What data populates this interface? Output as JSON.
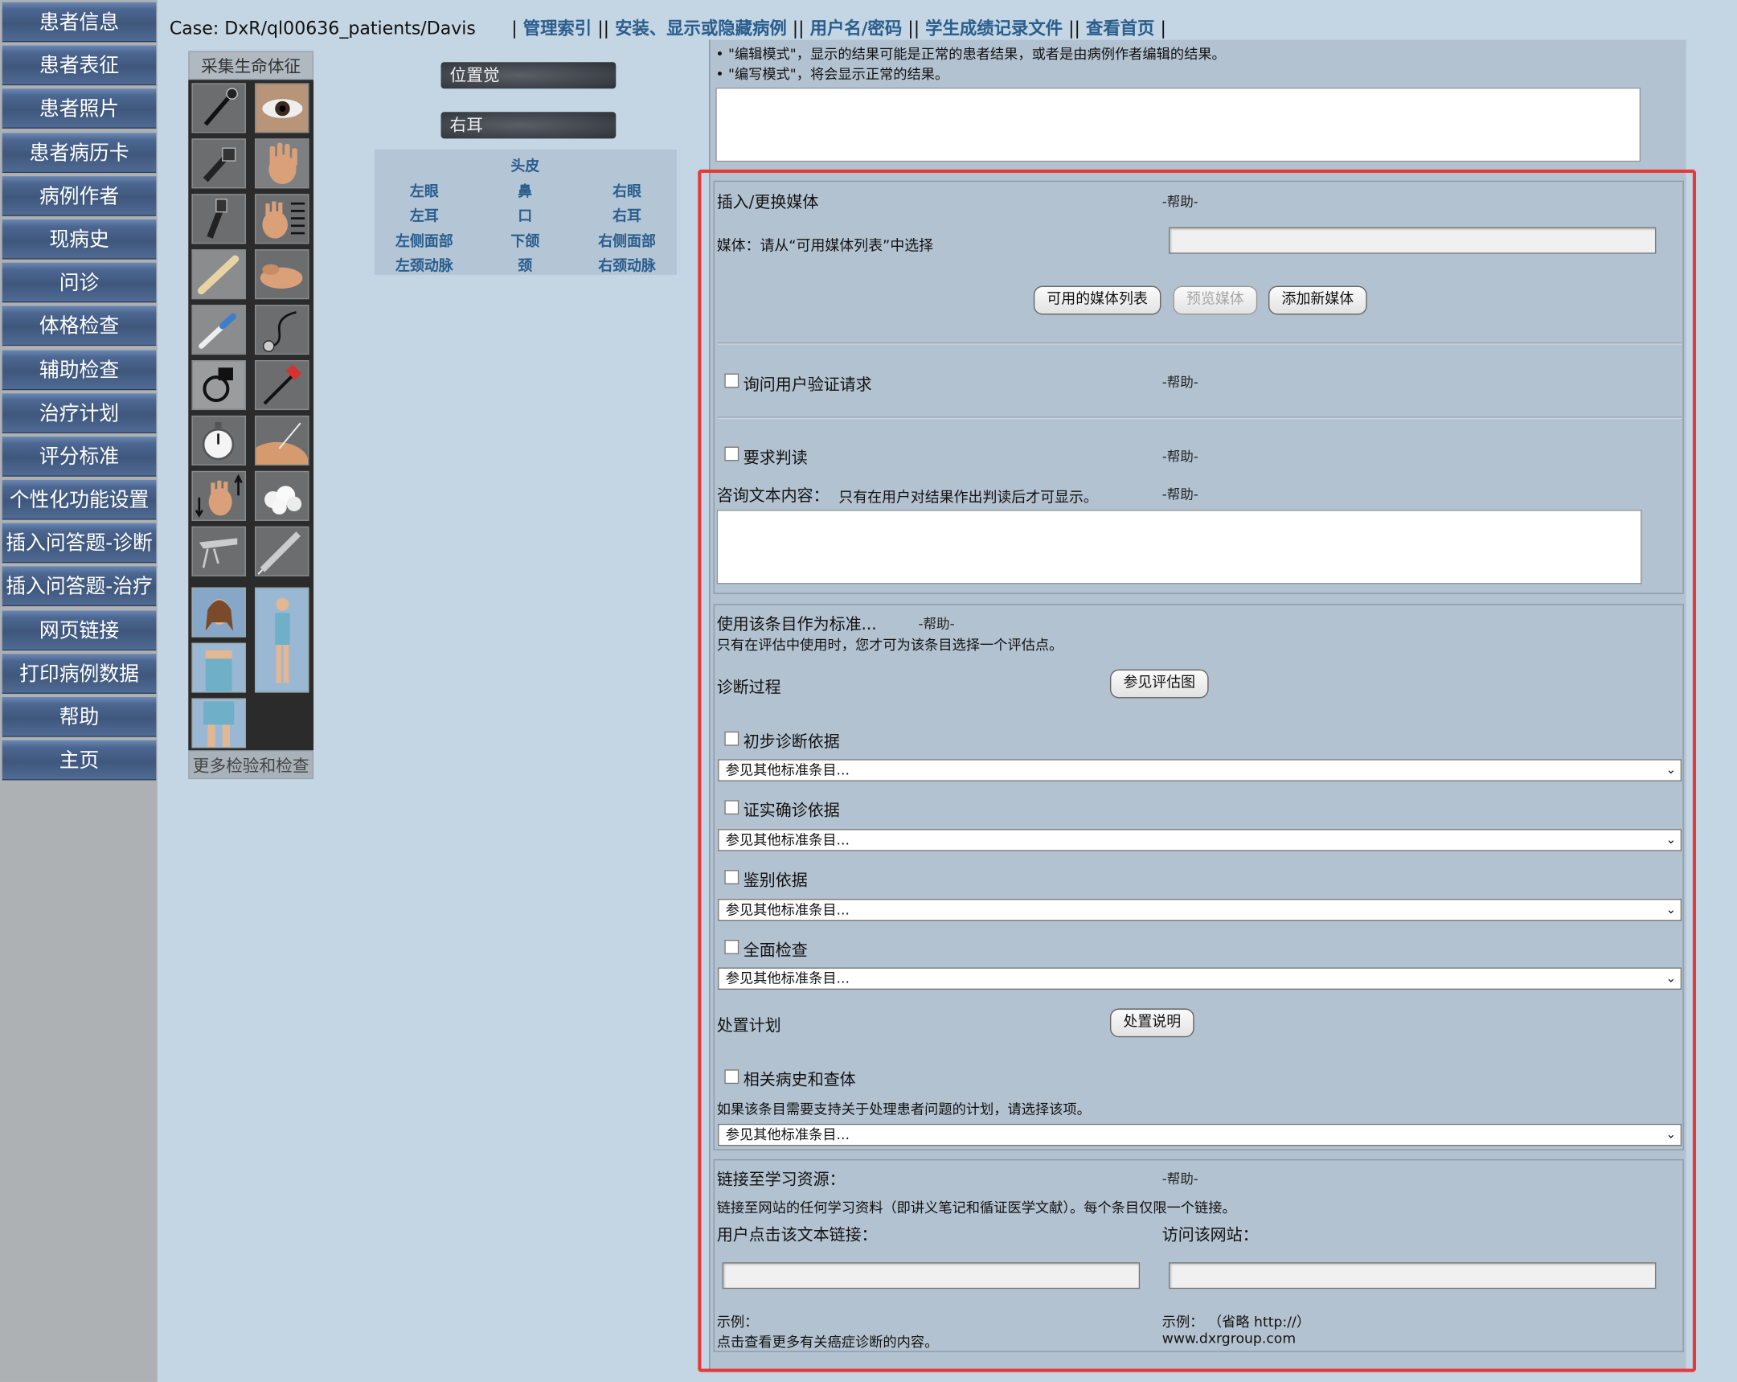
{
  "sidebar": {
    "items": [
      "患者信息",
      "患者表征",
      "患者照片",
      "患者病历卡",
      "病例作者",
      "现病史",
      "问诊",
      "体格检查",
      "辅助检查",
      "治疗计划",
      "评分标准",
      "个性化功能设置",
      "插入问答题-诊断",
      "插入问答题-治疗",
      "网页链接",
      "打印病例数据",
      "帮助",
      "主页"
    ]
  },
  "header": {
    "case": "Case: DxR/ql00636_patients/Davis",
    "links": [
      "管理索引",
      "安装、显示或隐藏病例",
      "用户名/密码",
      "学生成绩记录文件",
      "查看首页"
    ]
  },
  "tools": {
    "title": "采集生命体征",
    "more": "更多检验和检查",
    "icons": [
      "microphone-icon",
      "eye-icon",
      "otoscope-icon",
      "hand-icon",
      "ophthalmoscope-icon",
      "hand-measure-icon",
      "tongue-depressor-icon",
      "hand-palpate-icon",
      "thermometer-icon",
      "stethoscope-icon",
      "blood-pressure-icon",
      "reflex-hammer-icon",
      "stopwatch-icon",
      "needle-skin-icon",
      "hand-arrows-icon",
      "cotton-balls-icon",
      "speculum-icon",
      "syringe-icon"
    ]
  },
  "location": {
    "label1": "位置觉",
    "label2": "右耳",
    "cells": [
      "头皮",
      "左眼",
      "鼻",
      "右眼",
      "左耳",
      "口",
      "右耳",
      "左侧面部",
      "下颌",
      "右侧面部",
      "左颈动脉",
      "颈",
      "右颈动脉"
    ]
  },
  "top_note": {
    "line1": "• \"编辑模式\"，显示的结果可能是正常的患者结果，或者是由病例作者编辑的结果。",
    "line2": "• \"编写模式\"，将会显示正常的结果。"
  },
  "media": {
    "title": "插入/更换媒体",
    "help": "-帮助-",
    "media_label": "媒体：请从“可用媒体列表”中选择",
    "btn_list": "可用的媒体列表",
    "btn_preview": "预览媒体",
    "btn_add": "添加新媒体",
    "verify_label": "询问用户验证请求",
    "verify_help": "-帮助-",
    "interpret_label": "要求判读",
    "interpret_help": "-帮助-",
    "consult_label": "咨询文本内容：",
    "consult_note": "只有在用户对结果作出判读后才可显示。",
    "consult_help": "-帮助-"
  },
  "standard": {
    "title": "使用该条目作为标准...",
    "help": "-帮助-",
    "note": "只有在评估中使用时，您才可为该条目选择一个评估点。",
    "diag_label": "诊断过程",
    "diag_btn": "参见评估图",
    "cb1": "初步诊断依据",
    "cb2": "证实确诊依据",
    "cb3": "鉴别依据",
    "cb4": "全面检查",
    "plan_label": "处置计划",
    "plan_btn": "处置说明",
    "cb5": "相关病史和查体",
    "plan_note": "如果该条目需要支持关于处理患者问题的计划，请选择该项。",
    "select_value": "参见其他标准条目..."
  },
  "links": {
    "title": "链接至学习资源：",
    "help": "-帮助-",
    "note": "链接至网站的任何学习资料（即讲义笔记和循证医学文献）。每个条目仅限一个链接。",
    "text_label": "用户点击该文本链接：",
    "url_label": "访问该网站：",
    "ex1_label": "示例：",
    "ex1_value": "点击查看更多有关癌症诊断的内容。",
    "ex2_label": "示例：  （省略 http://）",
    "ex2_value": "www.dxrgroup.com"
  },
  "colors": {
    "highlight": "#e53a3a",
    "link": "#2a5e8d",
    "nav": "#4c6791"
  }
}
